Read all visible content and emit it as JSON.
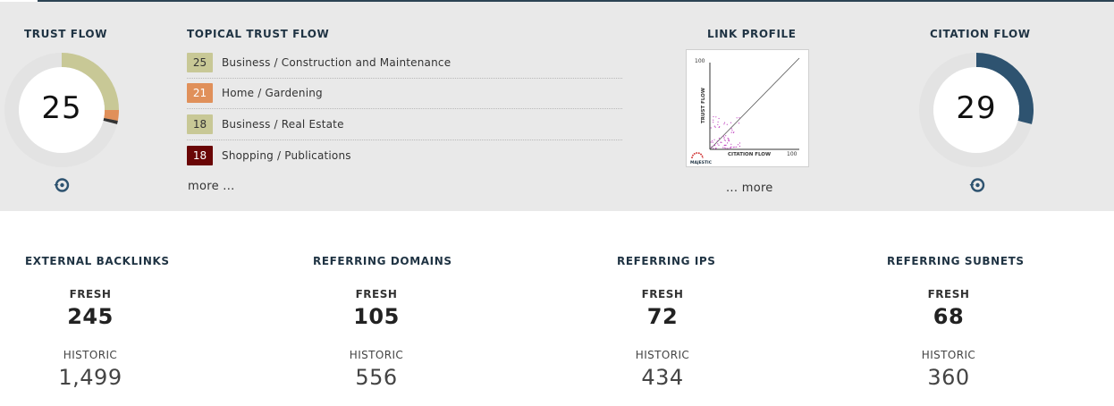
{
  "trust_flow": {
    "heading": "TRUST FLOW",
    "value": "25",
    "segments": [
      {
        "value": 25,
        "color": "#c8c896"
      },
      {
        "value": 3,
        "color": "#e0905a"
      },
      {
        "value": 1,
        "color": "#333333"
      }
    ],
    "track_color": "#e3e3e3",
    "icon": "history-icon"
  },
  "topical_trust_flow": {
    "heading": "TOPICAL TRUST FLOW",
    "items": [
      {
        "score": "25",
        "label": "Business / Construction and Maintenance",
        "color": "#c8c896",
        "text_color": "#333333"
      },
      {
        "score": "21",
        "label": "Home / Gardening",
        "color": "#e0905a",
        "text_color": "#ffffff"
      },
      {
        "score": "18",
        "label": "Business / Real Estate",
        "color": "#c8c896",
        "text_color": "#333333"
      },
      {
        "score": "18",
        "label": "Shopping / Publications",
        "color": "#6a0606",
        "text_color": "#ffffff"
      }
    ],
    "more_label": "more ..."
  },
  "link_profile": {
    "heading": "LINK PROFILE",
    "y_axis_label": "TRUST FLOW",
    "x_axis_label": "CITATION FLOW",
    "axis_max": "100",
    "brand": "MAJESTIC",
    "more_label": "... more",
    "point_color": "#c040c0"
  },
  "citation_flow": {
    "heading": "CITATION FLOW",
    "value": "29",
    "segments": [
      {
        "value": 29,
        "color": "#2e5370"
      }
    ],
    "track_color": "#e3e3e3",
    "icon": "history-icon"
  },
  "metrics": [
    {
      "title": "EXTERNAL BACKLINKS",
      "fresh_label": "FRESH",
      "fresh_value": "245",
      "historic_label": "HISTORIC",
      "historic_value": "1,499"
    },
    {
      "title": "REFERRING DOMAINS",
      "fresh_label": "FRESH",
      "fresh_value": "105",
      "historic_label": "HISTORIC",
      "historic_value": "556"
    },
    {
      "title": "REFERRING IPS",
      "fresh_label": "FRESH",
      "fresh_value": "72",
      "historic_label": "HISTORIC",
      "historic_value": "434"
    },
    {
      "title": "REFERRING SUBNETS",
      "fresh_label": "FRESH",
      "fresh_value": "68",
      "historic_label": "HISTORIC",
      "historic_value": "360"
    }
  ]
}
